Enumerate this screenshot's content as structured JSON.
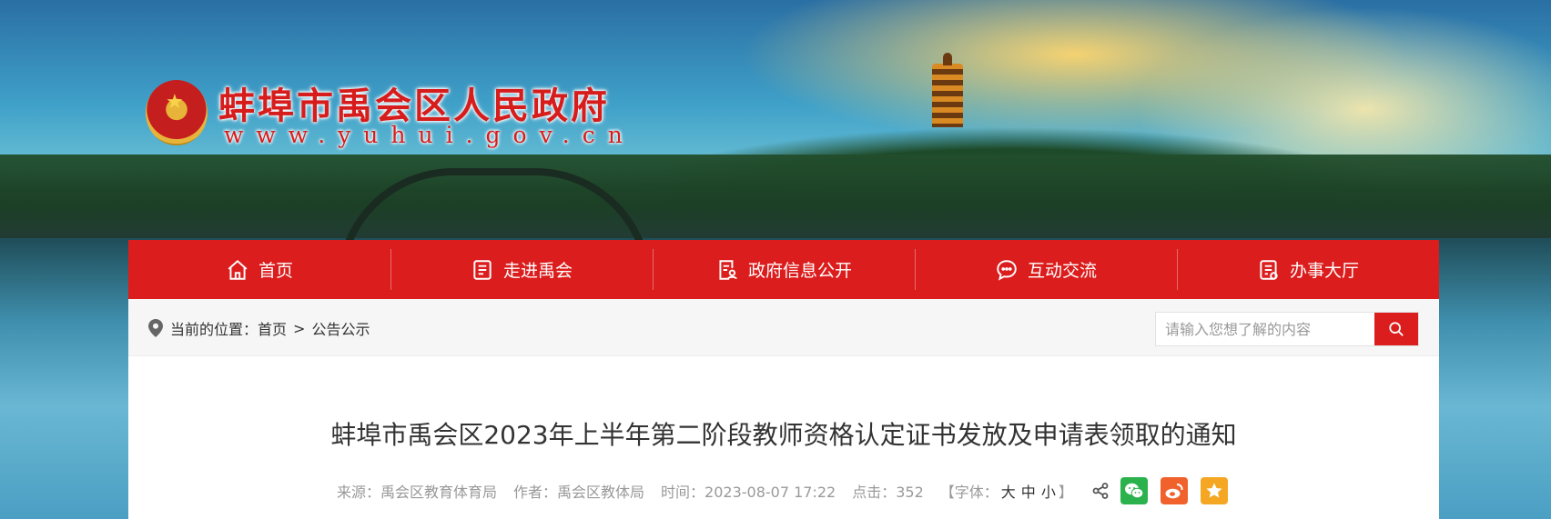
{
  "header": {
    "site_title": "蚌埠市禹会区人民政府",
    "site_url": "www.yuhui.gov.cn",
    "emblem": "national-emblem-icon"
  },
  "nav": {
    "items": [
      {
        "label": "首页",
        "icon": "home-icon"
      },
      {
        "label": "走进禹会",
        "icon": "list-icon"
      },
      {
        "label": "政府信息公开",
        "icon": "document-user-icon"
      },
      {
        "label": "互动交流",
        "icon": "chat-icon"
      },
      {
        "label": "办事大厅",
        "icon": "form-icon"
      }
    ],
    "bg_color": "#dc1d1d"
  },
  "breadcrumb": {
    "prefix": "当前的位置：",
    "home": "首页",
    "separator": ">",
    "current": "公告公示"
  },
  "search": {
    "placeholder": "请输入您想了解的内容"
  },
  "article": {
    "title": "蚌埠市禹会区2023年上半年第二阶段教师资格认定证书发放及申请表领取的通知",
    "source": "来源：禹会区教育体育局",
    "author": "作者：禹会区教体局",
    "time": "时间：2023-08-07 17:22",
    "clicks": "点击：352",
    "font_label": "【字体：",
    "font_large": "大",
    "font_medium": "中",
    "font_small": "小",
    "font_close": "】"
  },
  "share": {
    "icons": [
      "share-icon",
      "wechat-icon",
      "weibo-icon",
      "favorite-icon"
    ],
    "colors": {
      "wechat": "#2bb24c",
      "weibo": "#f0612b",
      "favorite": "#f5a623"
    }
  }
}
